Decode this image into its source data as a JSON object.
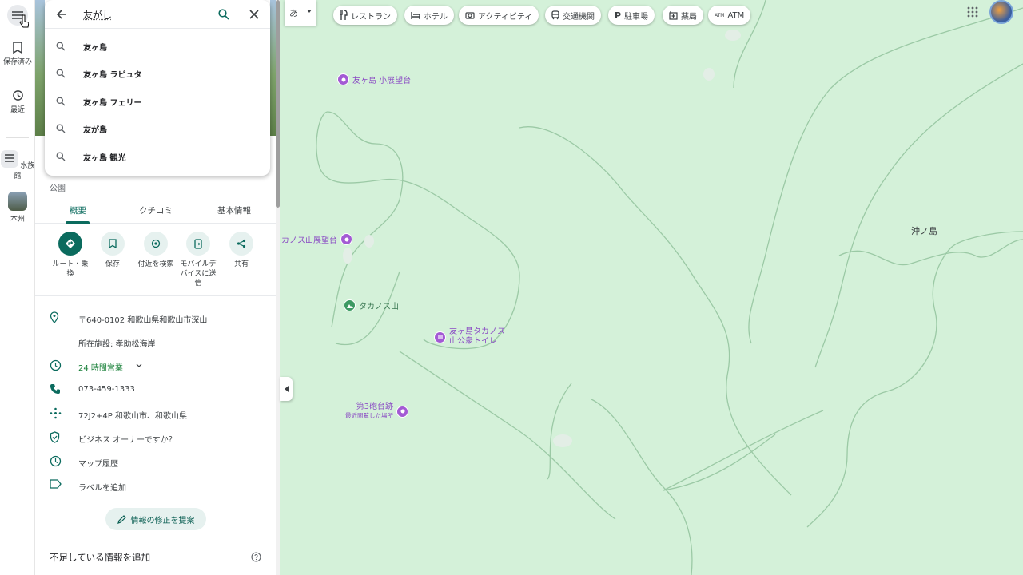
{
  "search": {
    "value": "友がし",
    "suggestions": [
      "友ヶ島",
      "友ヶ島 ラピュタ",
      "友ヶ島 フェリー",
      "友が島",
      "友ヶ島 観光"
    ]
  },
  "rail": {
    "saved": "保存済み",
    "recent": "最近",
    "item1": "水族館",
    "item2": "本州"
  },
  "place": {
    "category": "公園",
    "tabs": [
      "概要",
      "クチコミ",
      "基本情報"
    ]
  },
  "actions": [
    {
      "label": "ルート・乗\n換"
    },
    {
      "label": "保存"
    },
    {
      "label": "付近を検索"
    },
    {
      "label": "モバイルデ\nバイスに送\n信"
    },
    {
      "label": "共有"
    }
  ],
  "info": {
    "address": "〒640-0102 和歌山県和歌山市深山",
    "located_in": "所在施設: 孝助松海岸",
    "hours": "24 時間営業",
    "phone": "073-459-1333",
    "plus_code": "72J2+4P 和歌山市、和歌山県",
    "owner": "ビジネス オーナーですか？",
    "history": "マップ履歴",
    "label": "ラベルを追加"
  },
  "suggest_edit": "情報の修正を提案",
  "missing_info": "不足している情報を追加",
  "input_mode": "あ",
  "chips": [
    "レストラン",
    "ホテル",
    "アクティビティ",
    "交通機関",
    "駐車場",
    "薬局",
    "ATM"
  ],
  "map_labels": {
    "poi1": "友ヶ島 小展望台",
    "poi2": "カノス山展望台",
    "poi3": "タカノス山",
    "poi4_line1": "友ヶ島タカノス",
    "poi4_line2": "山公衆トイレ",
    "poi5_line1": "第3砲台跡",
    "poi5_line2": "最近閲覧した場所",
    "island": "沖ノ島"
  },
  "colors": {
    "accent": "#0b6b5e",
    "map_bg": "#d4f1d9",
    "poi": "#a35ad4"
  }
}
